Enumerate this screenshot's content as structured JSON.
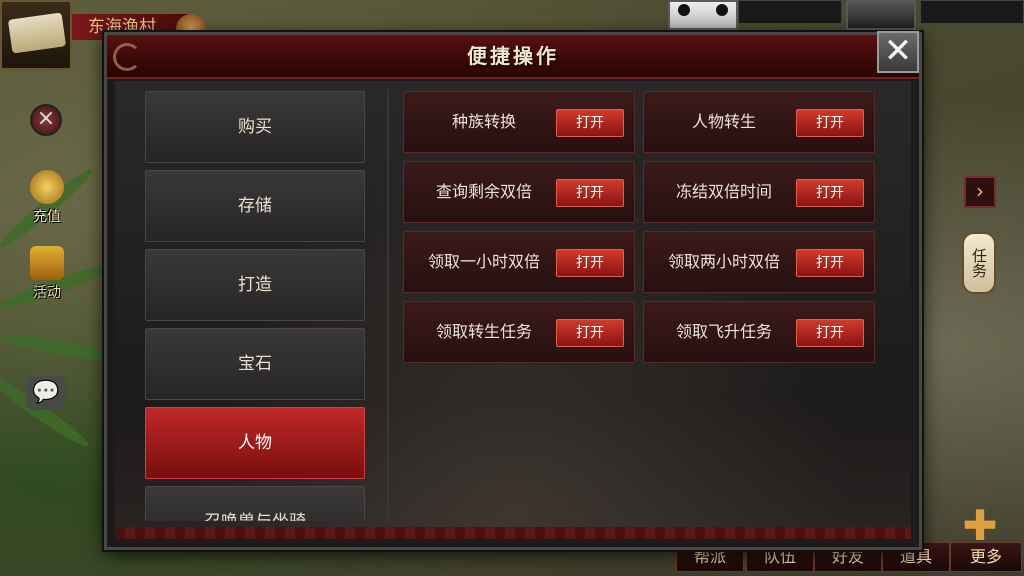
{
  "hud": {
    "area_name": "东海渔村",
    "side": {
      "recharge_label": "充值",
      "activity_label": "活动"
    },
    "quest_label": "任务",
    "bottom": [
      "帮派",
      "队伍",
      "好友",
      "道具",
      "更多"
    ],
    "hp_color": "#c03030",
    "mp_color": "#2e8fc8"
  },
  "dialog": {
    "title": "便捷操作",
    "close_icon": "close-icon",
    "categories": [
      {
        "label": "购买",
        "active": false
      },
      {
        "label": "存储",
        "active": false
      },
      {
        "label": "打造",
        "active": false
      },
      {
        "label": "宝石",
        "active": false
      },
      {
        "label": "人物",
        "active": true
      },
      {
        "label": "召唤兽与坐骑",
        "active": false
      }
    ],
    "operations": [
      {
        "label": "种族转换",
        "button": "打开"
      },
      {
        "label": "人物转生",
        "button": "打开"
      },
      {
        "label": "查询剩余双倍",
        "button": "打开"
      },
      {
        "label": "冻结双倍时间",
        "button": "打开"
      },
      {
        "label": "领取一小时双倍",
        "button": "打开"
      },
      {
        "label": "领取两小时双倍",
        "button": "打开"
      },
      {
        "label": "领取转生任务",
        "button": "打开"
      },
      {
        "label": "领取飞升任务",
        "button": "打开"
      }
    ],
    "accent_color": "#c02828"
  }
}
